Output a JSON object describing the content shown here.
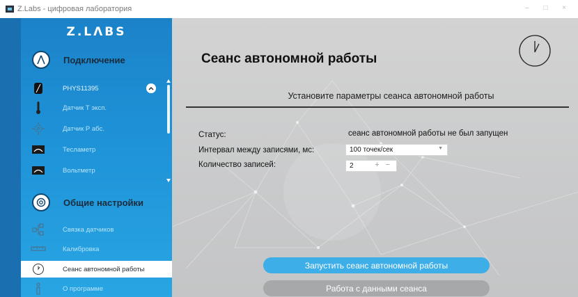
{
  "window": {
    "title": "Z.Labs - цифровая лаборатория",
    "controls": "– □ ×"
  },
  "sidebar": {
    "logo": "Z.LΛBS",
    "sections": [
      {
        "title": "Подключение",
        "icon": "compass-icon",
        "device": {
          "label": "PHYS11395",
          "icon": "device-icon",
          "collapse_icon": "chevron-up-icon"
        },
        "items": [
          {
            "label": "Датчик Т эксп.",
            "icon": "thermometer-icon"
          },
          {
            "label": "Датчик Р абс.",
            "icon": "pressure-sensor-icon"
          },
          {
            "label": "Тесламетр",
            "icon": "meter-icon"
          },
          {
            "label": "Вольтметр",
            "icon": "meter-icon"
          }
        ]
      },
      {
        "title": "Общие настройки",
        "icon": "settings-icon",
        "items": [
          {
            "label": "Связка датчиков",
            "icon": "network-icon"
          },
          {
            "label": "Калибровка",
            "icon": "ruler-icon"
          },
          {
            "label": "Сеанс автономной работы",
            "icon": "clock-icon",
            "active": true
          },
          {
            "label": "О программе",
            "icon": "info-icon"
          }
        ]
      }
    ],
    "colors": {
      "sidebar_top": "#1b82c8",
      "sidebar_bottom": "#28a5e3",
      "active_bg": "#ffffff"
    }
  },
  "main": {
    "title": "Сеанс автономной работы",
    "header_icon": "clock-icon",
    "subtitle": "Установите параметры сеанса автономной работы",
    "form": {
      "status_label": "Статус:",
      "status_value": "сеанс автономной работы не был запущен",
      "interval_label": "Интервал между записями, мс:",
      "interval_value": "100 точек/сек",
      "count_label": "Количество записей:",
      "count_value": "2",
      "count_ops": "+ −"
    },
    "buttons": {
      "start": "Запустить сеанс автономной работы",
      "data": "Работа с данными сеанса"
    },
    "colors": {
      "start_button": "#3eaee8",
      "data_button": "#a7a8aa",
      "background": "#cfcfcf"
    }
  }
}
